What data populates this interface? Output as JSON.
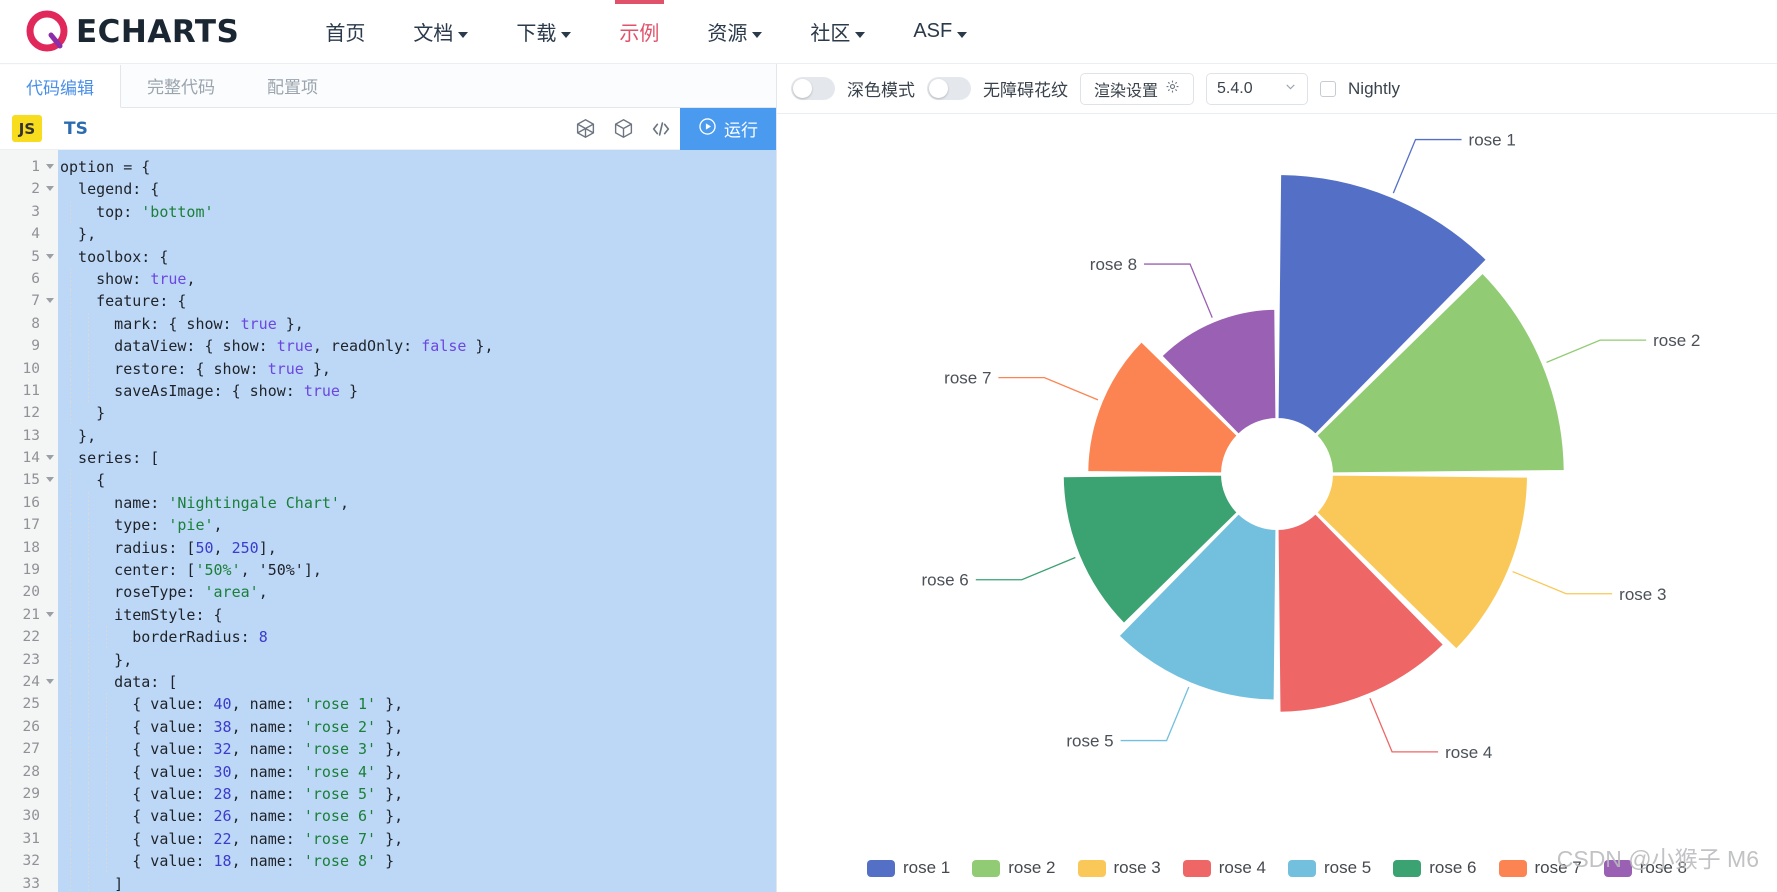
{
  "nav": {
    "brand": "ECHARTS",
    "items": [
      {
        "label": "首页",
        "dropdown": false,
        "active": false
      },
      {
        "label": "文档",
        "dropdown": true,
        "active": false
      },
      {
        "label": "下载",
        "dropdown": true,
        "active": false
      },
      {
        "label": "示例",
        "dropdown": false,
        "active": true
      },
      {
        "label": "资源",
        "dropdown": true,
        "active": false
      },
      {
        "label": "社区",
        "dropdown": true,
        "active": false
      },
      {
        "label": "ASF",
        "dropdown": true,
        "active": false
      }
    ]
  },
  "editor": {
    "tabs": [
      {
        "label": "代码编辑",
        "active": true
      },
      {
        "label": "完整代码",
        "active": false
      },
      {
        "label": "配置项",
        "active": false
      }
    ],
    "lang_js": "JS",
    "lang_ts": "TS",
    "toolbar_icons": [
      "globe-icon",
      "cube-icon",
      "code-icon"
    ],
    "run_label": "运行",
    "run_icon": "play-circle-icon",
    "lines": [
      {
        "n": 1,
        "fold": true,
        "indent": 0,
        "text": "option = {"
      },
      {
        "n": 2,
        "fold": true,
        "indent": 0,
        "text": "  legend: {"
      },
      {
        "n": 3,
        "fold": false,
        "indent": 1,
        "text": "    top: 'bottom'",
        "strings": [
          "'bottom'"
        ]
      },
      {
        "n": 4,
        "fold": false,
        "indent": 0,
        "text": "  },"
      },
      {
        "n": 5,
        "fold": true,
        "indent": 0,
        "text": "  toolbox: {"
      },
      {
        "n": 6,
        "fold": false,
        "indent": 1,
        "text": "    show: true,",
        "bools": [
          "true"
        ]
      },
      {
        "n": 7,
        "fold": true,
        "indent": 1,
        "text": "    feature: {"
      },
      {
        "n": 8,
        "fold": false,
        "indent": 2,
        "text": "      mark: { show: true },",
        "bools": [
          "true"
        ]
      },
      {
        "n": 9,
        "fold": false,
        "indent": 2,
        "text": "      dataView: { show: true, readOnly: false },",
        "bools": [
          "true",
          "false"
        ]
      },
      {
        "n": 10,
        "fold": false,
        "indent": 2,
        "text": "      restore: { show: true },",
        "bools": [
          "true"
        ]
      },
      {
        "n": 11,
        "fold": false,
        "indent": 2,
        "text": "      saveAsImage: { show: true }",
        "bools": [
          "true"
        ]
      },
      {
        "n": 12,
        "fold": false,
        "indent": 1,
        "text": "    }"
      },
      {
        "n": 13,
        "fold": false,
        "indent": 0,
        "text": "  },"
      },
      {
        "n": 14,
        "fold": true,
        "indent": 0,
        "text": "  series: ["
      },
      {
        "n": 15,
        "fold": true,
        "indent": 1,
        "text": "    {"
      },
      {
        "n": 16,
        "fold": false,
        "indent": 2,
        "text": "      name: 'Nightingale Chart',",
        "strings": [
          "'Nightingale Chart'"
        ]
      },
      {
        "n": 17,
        "fold": false,
        "indent": 2,
        "text": "      type: 'pie',",
        "strings": [
          "'pie'"
        ]
      },
      {
        "n": 18,
        "fold": false,
        "indent": 2,
        "text": "      radius: [50, 250],",
        "nums": [
          "50",
          "250"
        ]
      },
      {
        "n": 19,
        "fold": false,
        "indent": 2,
        "text": "      center: ['50%', '50%'],",
        "strings": [
          "'50%'",
          "'50%'"
        ]
      },
      {
        "n": 20,
        "fold": false,
        "indent": 2,
        "text": "      roseType: 'area',",
        "strings": [
          "'area'"
        ]
      },
      {
        "n": 21,
        "fold": true,
        "indent": 2,
        "text": "      itemStyle: {"
      },
      {
        "n": 22,
        "fold": false,
        "indent": 3,
        "text": "        borderRadius: 8",
        "nums": [
          "8"
        ]
      },
      {
        "n": 23,
        "fold": false,
        "indent": 2,
        "text": "      },"
      },
      {
        "n": 24,
        "fold": true,
        "indent": 2,
        "text": "      data: ["
      },
      {
        "n": 25,
        "fold": false,
        "indent": 3,
        "text": "        { value: 40, name: 'rose 1' },",
        "nums": [
          "40"
        ],
        "strings": [
          "'rose 1'"
        ]
      },
      {
        "n": 26,
        "fold": false,
        "indent": 3,
        "text": "        { value: 38, name: 'rose 2' },",
        "nums": [
          "38"
        ],
        "strings": [
          "'rose 2'"
        ]
      },
      {
        "n": 27,
        "fold": false,
        "indent": 3,
        "text": "        { value: 32, name: 'rose 3' },",
        "nums": [
          "32"
        ],
        "strings": [
          "'rose 3'"
        ]
      },
      {
        "n": 28,
        "fold": false,
        "indent": 3,
        "text": "        { value: 30, name: 'rose 4' },",
        "nums": [
          "30"
        ],
        "strings": [
          "'rose 4'"
        ]
      },
      {
        "n": 29,
        "fold": false,
        "indent": 3,
        "text": "        { value: 28, name: 'rose 5' },",
        "nums": [
          "28"
        ],
        "strings": [
          "'rose 5'"
        ]
      },
      {
        "n": 30,
        "fold": false,
        "indent": 3,
        "text": "        { value: 26, name: 'rose 6' },",
        "nums": [
          "26"
        ],
        "strings": [
          "'rose 6'"
        ]
      },
      {
        "n": 31,
        "fold": false,
        "indent": 3,
        "text": "        { value: 22, name: 'rose 7' },",
        "nums": [
          "22"
        ],
        "strings": [
          "'rose 7'"
        ]
      },
      {
        "n": 32,
        "fold": false,
        "indent": 3,
        "text": "        { value: 18, name: 'rose 8' }",
        "nums": [
          "18"
        ],
        "strings": [
          "'rose 8'"
        ]
      },
      {
        "n": 33,
        "fold": false,
        "indent": 2,
        "text": "      ]"
      }
    ]
  },
  "controls": {
    "dark_mode_label": "深色模式",
    "dark_mode_on": false,
    "pattern_label": "无障碍花纹",
    "pattern_on": false,
    "render_settings_label": "渲染设置",
    "render_settings_icon": "gear-icon",
    "version_value": "5.4.0",
    "version_caret": "chevron-down-icon",
    "nightly_label": "Nightly",
    "nightly_checked": false
  },
  "chart_data": {
    "type": "pie",
    "title": "Nightingale Chart",
    "subtype": "rose-area",
    "inner_radius": 50,
    "outer_radius": 250,
    "border_radius": 8,
    "legend_position": "bottom",
    "categories": [
      "rose 1",
      "rose 2",
      "rose 3",
      "rose 4",
      "rose 5",
      "rose 6",
      "rose 7",
      "rose 8"
    ],
    "values": [
      40,
      38,
      32,
      30,
      28,
      26,
      22,
      18
    ],
    "colors": [
      "#5470c6",
      "#91cc75",
      "#fac858",
      "#ee6666",
      "#73c0de",
      "#3ba272",
      "#fc8452",
      "#9a60b4"
    ],
    "labels": [
      {
        "name": "rose 1",
        "side": "right"
      },
      {
        "name": "rose 2",
        "side": "right"
      },
      {
        "name": "rose 3",
        "side": "right"
      },
      {
        "name": "rose 4",
        "side": "right"
      },
      {
        "name": "rose 5",
        "side": "left"
      },
      {
        "name": "rose 6",
        "side": "left"
      },
      {
        "name": "rose 7",
        "side": "left"
      },
      {
        "name": "rose 8",
        "side": "left"
      }
    ]
  },
  "watermark": "CSDN @小猴子 M6",
  "theme": {
    "accent_pink": "#e0526a",
    "accent_blue": "#4a9af0",
    "code_selection": "#bdd8f7"
  }
}
